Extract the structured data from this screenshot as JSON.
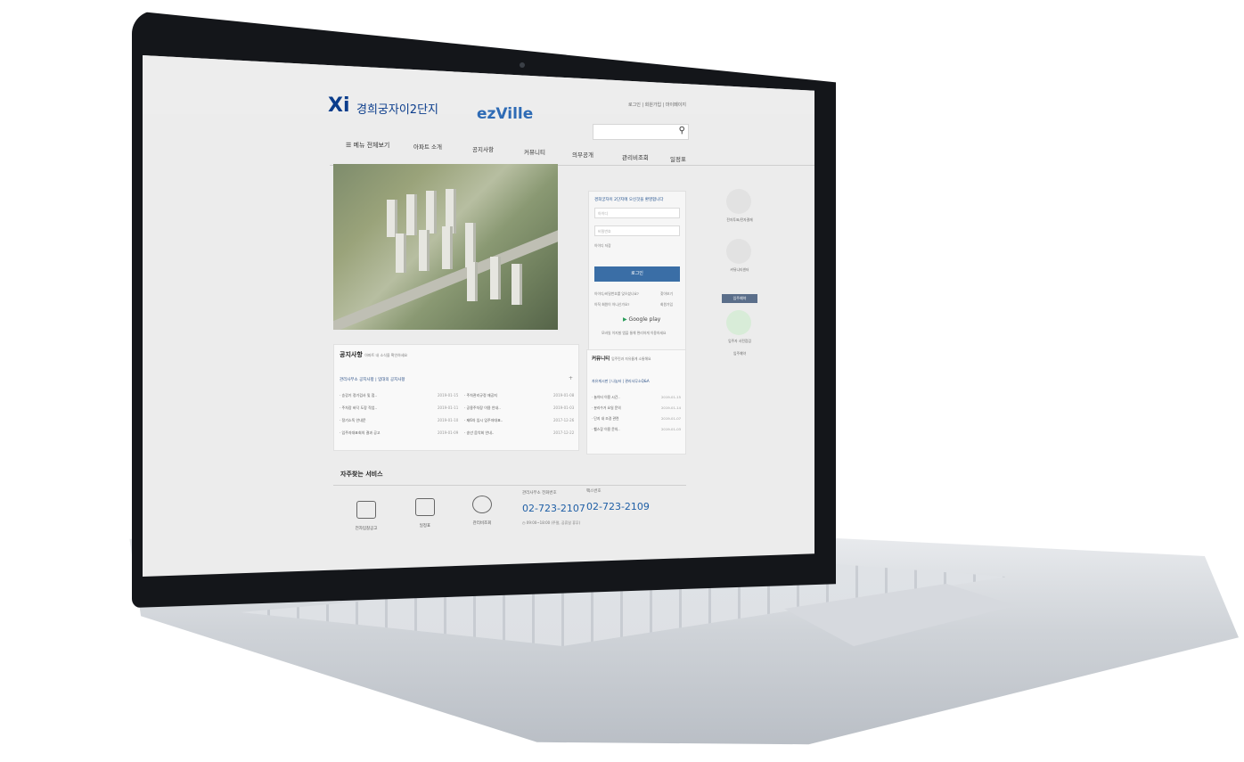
{
  "header": {
    "logo_mark": "Xi",
    "logo_name": "경희궁자이2단지",
    "brand": "ezVille",
    "top_links": "로그인 | 회원가입 | 마이페이지",
    "search_placeholder": ""
  },
  "nav": {
    "menu_all": "☰ 메뉴 전체보기",
    "items": [
      "아파트 소개",
      "공지사항",
      "커뮤니티",
      "의무공개",
      "관리비조회",
      "일정표"
    ]
  },
  "login": {
    "title": "경희궁자이 2단지에 오신것을 환영합니다",
    "id_placeholder": "아이디",
    "pw_placeholder": "비밀번호",
    "remember": "아이디 저장",
    "login_button": "로그인",
    "find_text": "아이디/비밀번호를 잊으셨나요?",
    "find_button": "찾아보기",
    "join_text": "아직 회원이 아니신가요?",
    "join_button": "회원가입",
    "google_play": "Google play",
    "app_text": "모바일 이지빌 앱을 통해 편리하게 이용하세요"
  },
  "side": {
    "item1": "전자투표/전자결재",
    "item2": "커뮤니티센터",
    "tag": "입주예약",
    "item3": "입주자 사전점검",
    "item4": "입주예약"
  },
  "notice": {
    "title": "공지사항",
    "subtitle": "아파트 내 소식을 확인하세요",
    "tab1": "관리사무소 공지사항",
    "tab2": "입대의 공지사항",
    "rows": [
      {
        "t1": "· 승강기 정기검사 및 점..",
        "d1": "2019-01-15",
        "t2": "· 주차관리규정 재공지",
        "d2": "2019-01-08"
      },
      {
        "t1": "· 주차장 바닥 도장 작업..",
        "d1": "2019-01-11",
        "t2": "· 공용주차장 이용 안내..",
        "d2": "2019-01-03"
      },
      {
        "t1": "· 정기소독 안내문",
        "d1": "2019-01-10",
        "t2": "· 제6차 임시 입주자대표..",
        "d2": "2017-12-26"
      },
      {
        "t1": "· 입주자대표회의 결과 공고",
        "d1": "2019-01-09",
        "t2": "· 송년 음악회 안내..",
        "d2": "2017-12-22"
      }
    ]
  },
  "community": {
    "title": "커뮤니티",
    "subtitle": "입주민과 자유롭게 소통해요",
    "tabs": "자유게시판  | 나눔터  | 관리사무소Q&A",
    "rows": [
      {
        "t": "· 놀이터 이용 시간..",
        "d": "2019-01-15"
      },
      {
        "t": "· 분리수거 요일 문의",
        "d": "2019-01-14"
      },
      {
        "t": "· 단지 내 조경 관련",
        "d": "2019-01-07"
      },
      {
        "t": "· 헬스장 이용 문의..",
        "d": "2019-01-03"
      }
    ]
  },
  "services": {
    "title": "자주찾는 서비스",
    "items": [
      "전자입찰공고",
      "일정표",
      "관리비조회"
    ],
    "office_label": "관리사무소 전화번호",
    "office_number": "02-723-2107",
    "fax_label": "팩스번호",
    "fax_number": "02-723-2109",
    "hours": "09:00~18:00 (주말, 공휴일 휴무)"
  }
}
